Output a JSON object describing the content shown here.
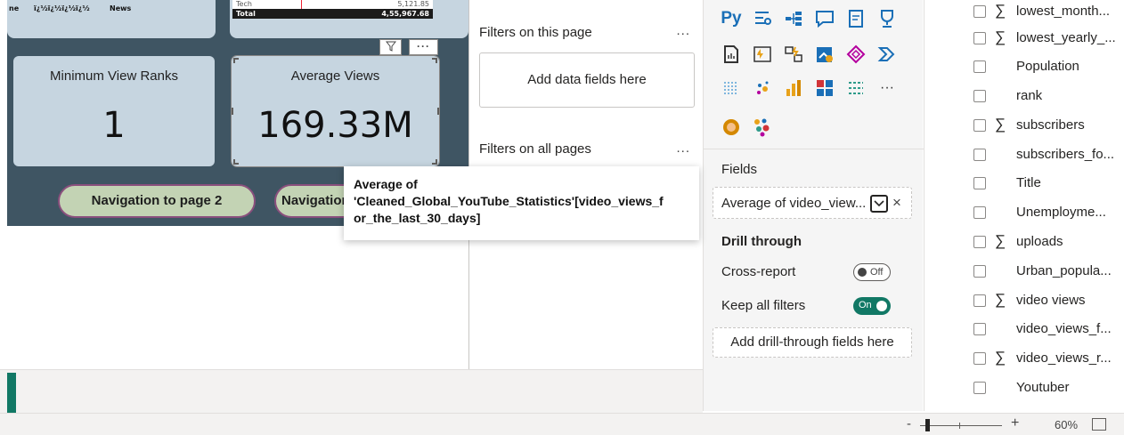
{
  "report": {
    "top_left_labels": [
      "ne",
      "ï¿½ï¿½ï¿½ï¿½",
      "News"
    ],
    "mini_table": {
      "row_label": "Tech",
      "row_value": "5,121.85",
      "total_label": "Total",
      "total_value": "4,55,967.68"
    },
    "kpis": [
      {
        "title": "Minimum View Ranks",
        "value": "1"
      },
      {
        "title": "Average Views",
        "value": "169.33M"
      }
    ],
    "nav_buttons": [
      "Navigation to page 2",
      "Navigation to page 3"
    ],
    "visual_header_icons": [
      "filter-icon",
      "more-options-icon"
    ]
  },
  "tooltip": {
    "text": "Average of 'Cleaned_Global_YouTube_Statistics'[video_views_for_the_last_30_days]",
    "line1": "Average of",
    "line2": "'Cleaned_Global_YouTube_Statistics'[video_views_f",
    "line3": "or_the_last_30_days]"
  },
  "filters": {
    "this_page_label": "Filters on this page",
    "add_fields_label": "Add data fields here",
    "all_pages_label": "Filters on all pages",
    "more": "..."
  },
  "visualizations": {
    "icons": [
      "python-visual-icon",
      "key-influencers-icon",
      "decomposition-tree-icon",
      "qa-icon",
      "smart-narrative-icon",
      "metrics-trophy-icon",
      "paginated-report-icon",
      "power-apps-icon",
      "power-automate-icon",
      "azure-map-icon",
      "diamond-visual-icon",
      "chevron-visual-icon",
      "scatter-dots-icon",
      "map-pin-icon",
      "bar-chart-icon",
      "grid-visual-icon",
      "table-visual-icon",
      "more-visuals-icon",
      "custom-visual-icon",
      "dots-visual-icon"
    ],
    "fields_label": "Fields",
    "field_chip": "Average of video_view...",
    "drill_through_label": "Drill through",
    "cross_report_label": "Cross-report",
    "cross_report_state": "Off",
    "keep_filters_label": "Keep all filters",
    "keep_filters_state": "On",
    "add_drill_label": "Add drill-through fields here",
    "accent": "#117865"
  },
  "data_fields": [
    {
      "label": "lowest_month...",
      "sigma": true
    },
    {
      "label": "lowest_yearly_...",
      "sigma": true
    },
    {
      "label": "Population",
      "sigma": false
    },
    {
      "label": "rank",
      "sigma": false
    },
    {
      "label": "subscribers",
      "sigma": true
    },
    {
      "label": "subscribers_fo...",
      "sigma": false
    },
    {
      "label": "Title",
      "sigma": false
    },
    {
      "label": "Unemployme...",
      "sigma": false
    },
    {
      "label": "uploads",
      "sigma": true
    },
    {
      "label": "Urban_popula...",
      "sigma": false
    },
    {
      "label": "video views",
      "sigma": true
    },
    {
      "label": "video_views_f...",
      "sigma": false
    },
    {
      "label": "video_views_r...",
      "sigma": true
    },
    {
      "label": "Youtuber",
      "sigma": false
    }
  ],
  "status": {
    "zoom_minus": "-",
    "zoom_plus": "+",
    "zoom": "60%"
  }
}
